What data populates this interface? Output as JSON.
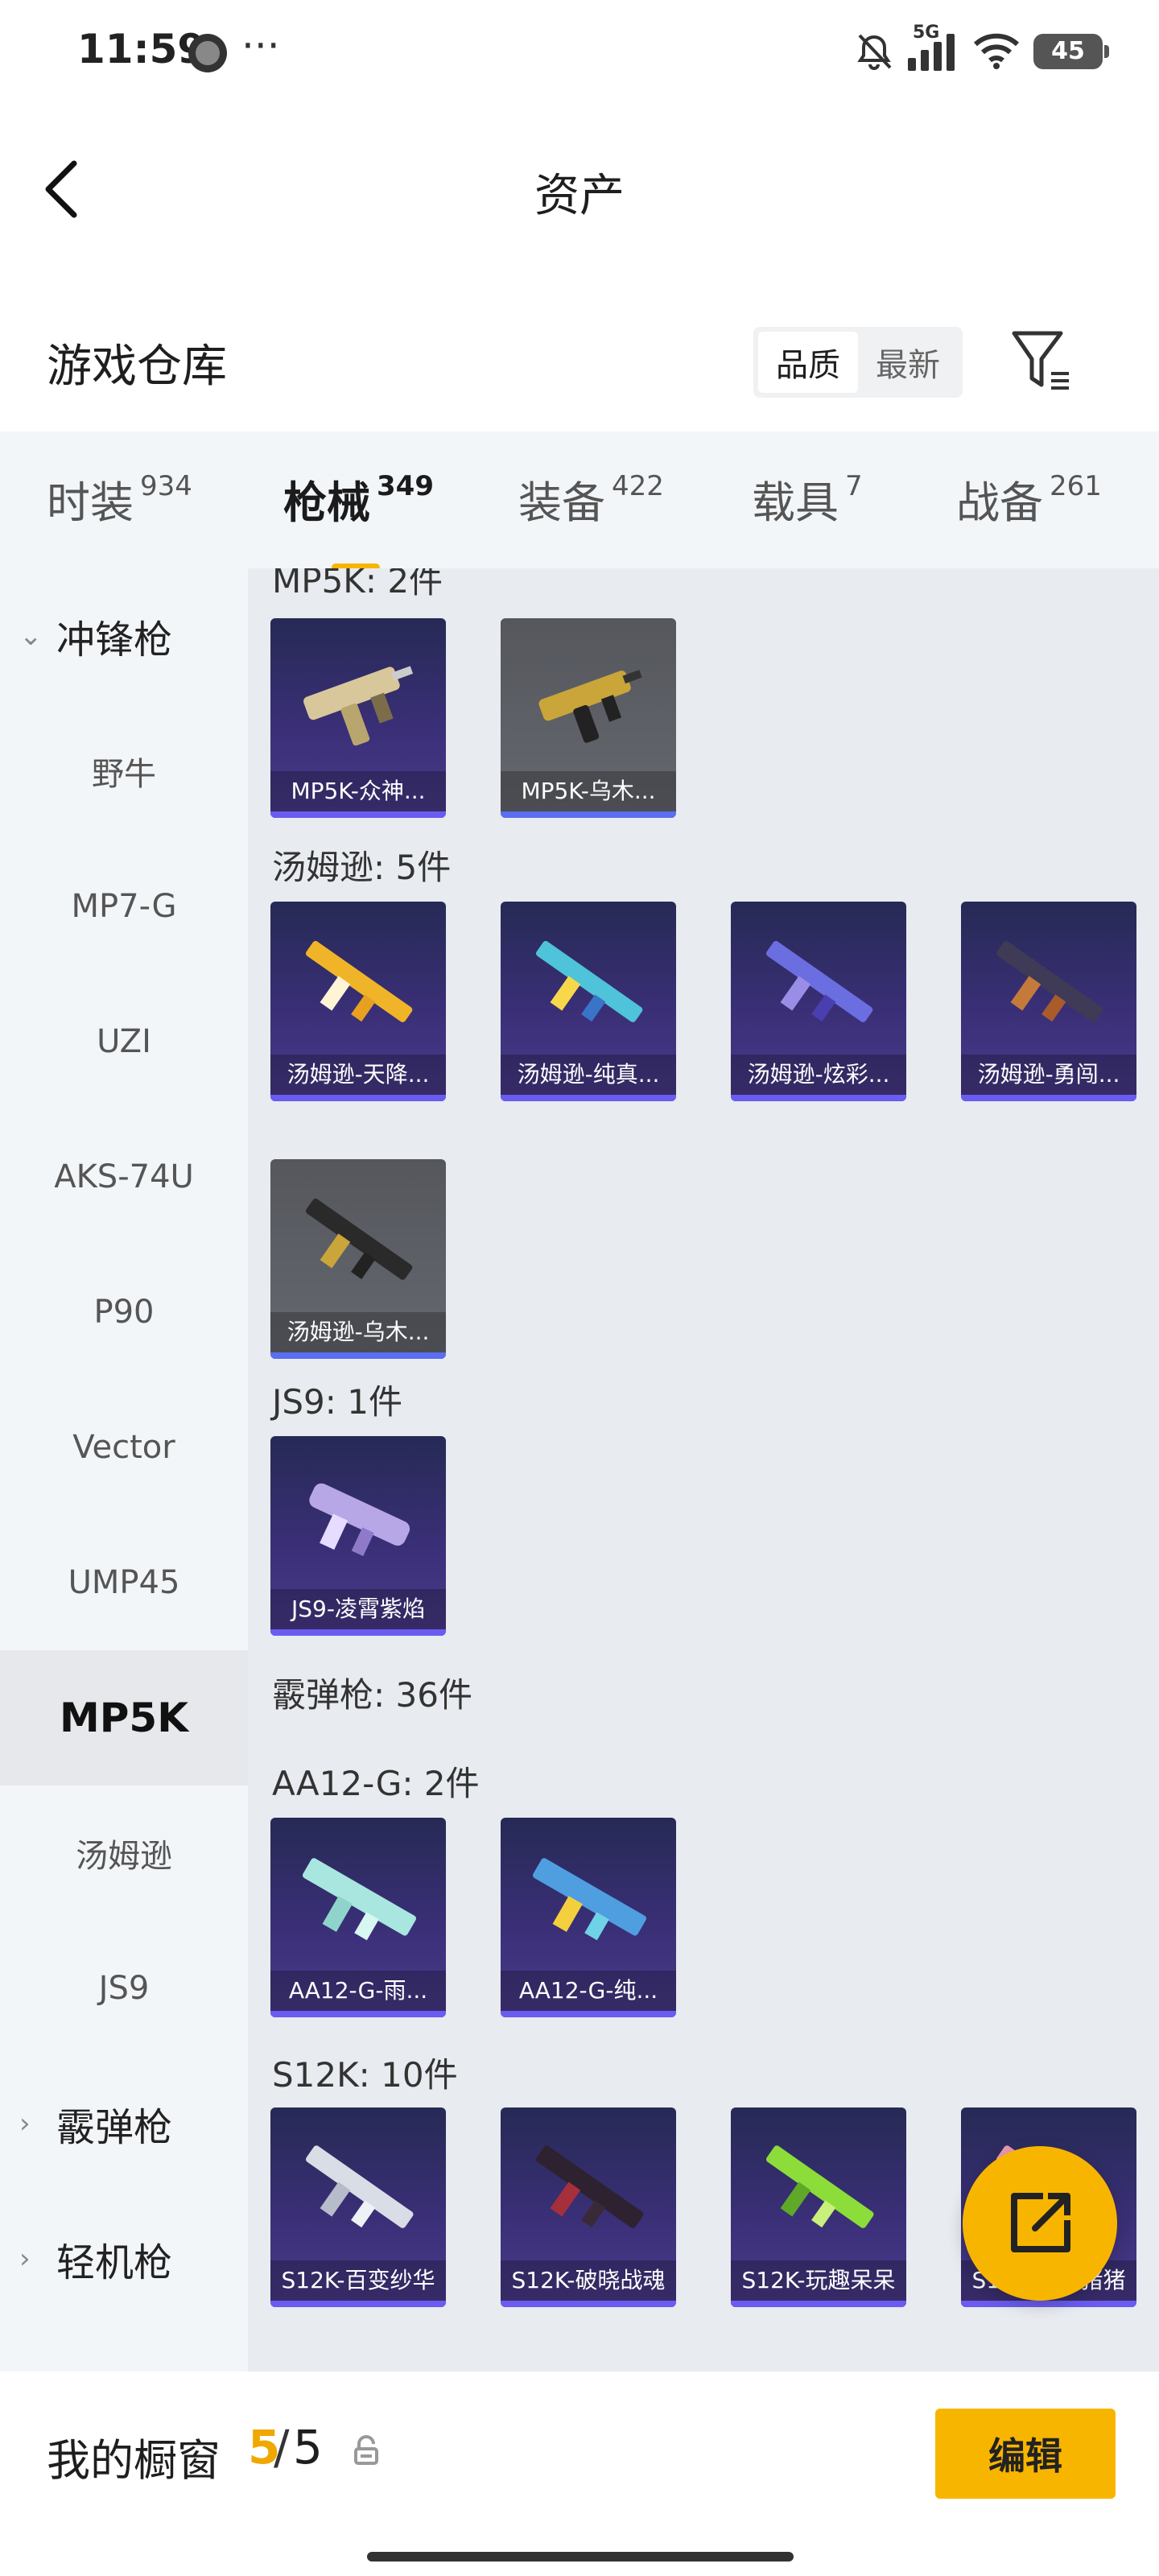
{
  "status": {
    "time": "11:59",
    "dots": "···",
    "network": "5G",
    "battery": "45"
  },
  "header": {
    "title": "资产"
  },
  "warehouse": {
    "title": "游戏仓库",
    "sort_options": [
      "品质",
      "最新"
    ]
  },
  "tabs": [
    {
      "label": "时装",
      "count": "934"
    },
    {
      "label": "枪械",
      "count": "349"
    },
    {
      "label": "装备",
      "count": "422"
    },
    {
      "label": "载具",
      "count": "7"
    },
    {
      "label": "战备",
      "count": "261"
    }
  ],
  "sidebar": {
    "items": [
      {
        "label": "冲锋枪",
        "type": "group"
      },
      {
        "label": "野牛"
      },
      {
        "label": "MP7-G"
      },
      {
        "label": "UZI"
      },
      {
        "label": "AKS-74U"
      },
      {
        "label": "P90"
      },
      {
        "label": "Vector"
      },
      {
        "label": "UMP45"
      },
      {
        "label": "MP5K"
      },
      {
        "label": "汤姆逊"
      },
      {
        "label": "JS9"
      },
      {
        "label": "霰弹枪",
        "type": "group"
      },
      {
        "label": "轻机枪",
        "type": "group"
      }
    ]
  },
  "sections": [
    {
      "title": "MP5K: 2件",
      "items": [
        "MP5K-众神...",
        "MP5K-乌木..."
      ]
    },
    {
      "title": "汤姆逊: 5件",
      "items": [
        "汤姆逊-天降...",
        "汤姆逊-纯真...",
        "汤姆逊-炫彩...",
        "汤姆逊-勇闯...",
        "汤姆逊-乌木..."
      ]
    },
    {
      "title": "JS9: 1件",
      "items": [
        "JS9-凌霄紫焰"
      ]
    },
    {
      "title": "霰弹枪: 36件"
    },
    {
      "title": "AA12-G: 2件",
      "items": [
        "AA12-G-雨...",
        "AA12-G-纯..."
      ]
    },
    {
      "title": "S12K: 10件",
      "items": [
        "S12K-百变纱华",
        "S12K-破晓战魂",
        "S12K-玩趣呆呆",
        "S12K-娇憨猪猪"
      ]
    }
  ],
  "showcase": {
    "label": "我的橱窗",
    "used": "5",
    "slash": "/",
    "total": "5",
    "edit": "编辑"
  },
  "colors": {
    "accent": "#f8b500",
    "card_purple": "#3a2f77",
    "card_gray": "#5f6168"
  }
}
